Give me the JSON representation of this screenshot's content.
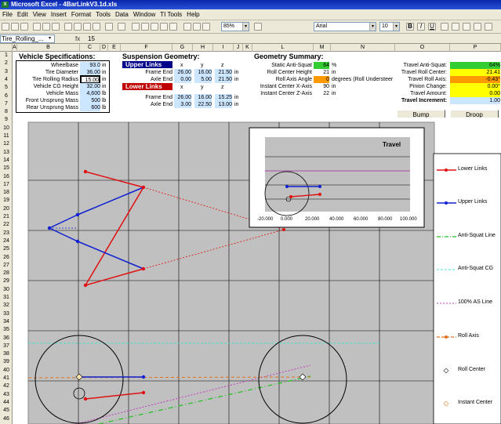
{
  "title": "Microsoft Excel - 4BarLinkV3.1d.xls",
  "menus": [
    "File",
    "Edit",
    "View",
    "Insert",
    "Format",
    "Tools",
    "Data",
    "Window",
    "TI Tools",
    "Help"
  ],
  "toolbar": {
    "zoom": "85%",
    "font": "Arial",
    "size": "10",
    "bold": "B",
    "italic": "I",
    "underline": "U"
  },
  "namebox": "Tire_Rolling_...",
  "fx": "fx",
  "formula": "15",
  "columns": [
    "A",
    "B",
    "C",
    "D",
    "E",
    "F",
    "G",
    "H",
    "I",
    "J",
    "K",
    "L",
    "M",
    "N",
    "O",
    "P"
  ],
  "rows": [
    "1",
    "2",
    "3",
    "4",
    "5",
    "6",
    "7",
    "8",
    "9",
    "10",
    "11",
    "12",
    "13",
    "14",
    "15",
    "16",
    "17",
    "18",
    "19",
    "20",
    "21",
    "22",
    "23",
    "24",
    "25",
    "26",
    "27",
    "28",
    "29",
    "30",
    "31",
    "32",
    "33",
    "34",
    "35",
    "36",
    "37",
    "38",
    "39",
    "40",
    "41",
    "42",
    "43",
    "44",
    "45",
    "46"
  ],
  "vehicle": {
    "title": "Vehicle Specifications:",
    "labels": [
      "Wheelbase",
      "Tire Diameter",
      "Tire Rolling Radius",
      "Vehicle CG Height",
      "Vehicle Mass",
      "Front Unsprung Mass",
      "Rear Unsprung Mass"
    ],
    "values": [
      "93.0",
      "36.00",
      "15.00",
      "32.00",
      "4,600",
      "500",
      "600"
    ],
    "units": [
      "in",
      "in",
      "in",
      "in",
      "lb",
      "lb",
      "lb"
    ]
  },
  "suspension": {
    "title": "Suspension Geometry:",
    "upper": "Upper Links",
    "lower": "Lower Links",
    "x": "x",
    "y": "y",
    "z": "z",
    "frame": "Frame End",
    "axle": "Axle End",
    "upper_frame": [
      "26.00",
      "16.00",
      "21.50"
    ],
    "upper_axle": [
      "0.00",
      "5.00",
      "21.50"
    ],
    "lower_frame": [
      "26.00",
      "16.00",
      "15.25"
    ],
    "lower_axle": [
      "3.00",
      "22.50",
      "13.00"
    ],
    "unit": "in"
  },
  "summary": {
    "title": "Geometry Summary:",
    "labels": [
      "Static Anti-Squat",
      "Roll Center Height",
      "Roll Axis Angle",
      "Instant Center X-Axis",
      "Instant Center Z-Axis"
    ],
    "values": [
      "64",
      "21",
      "0",
      "90",
      "22"
    ],
    "units": [
      "%",
      "in",
      "degrees (Roll Understeer",
      "in",
      "in"
    ]
  },
  "travel": {
    "labels": [
      "Travel Anti-Squat:",
      "Travel Roll Center:",
      "Travel Roll Axis:",
      "Pinion Change:",
      "Travel Amount:",
      "Travel Increment:"
    ],
    "values": [
      "64%",
      "21.41",
      "-0.43°",
      "0.00°",
      "0.00",
      "1.00"
    ]
  },
  "buttons": {
    "bump": "Bump",
    "droop": "Droop"
  },
  "inset": {
    "title": "Travel",
    "xticks": [
      "-20.000",
      "0.000",
      "20.000",
      "40.000",
      "60.000",
      "80.000",
      "100.000"
    ]
  },
  "legend": [
    "Lower Links",
    "Upper Links",
    "Anti-Squat Line",
    "Anti-Squat CG",
    "100% AS Line",
    "Roll Axis",
    "Roll Center",
    "Instant Center"
  ],
  "colors": {
    "lower": "#e01010",
    "upper": "#1020d0",
    "antisquat": "#20c020",
    "ascg": "#40e0d0",
    "as100": "#c040c0",
    "rollaxis": "#e07020",
    "rollcenter": "#404040",
    "instant": "#e0a060"
  }
}
